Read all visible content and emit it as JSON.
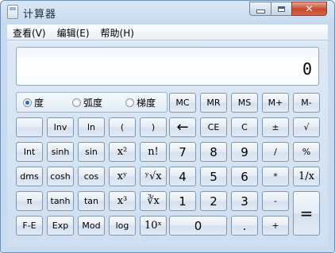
{
  "window": {
    "title": "计算器",
    "close_label": "✕"
  },
  "menu": [
    "查看(V)",
    "编辑(E)",
    "帮助(H)"
  ],
  "display": {
    "value": "0"
  },
  "angle_units": [
    {
      "label": "度",
      "selected": true
    },
    {
      "label": "弧度",
      "selected": false
    },
    {
      "label": "梯度",
      "selected": false
    }
  ],
  "memory_buttons": [
    "MC",
    "MR",
    "MS",
    "M+",
    "M-"
  ],
  "rows": {
    "r1": [
      "",
      "Inv",
      "ln",
      "(",
      ")",
      "←",
      "CE",
      "C",
      "±",
      "√"
    ],
    "r2": [
      "Int",
      "sinh",
      "sin",
      "x²",
      "n!",
      "7",
      "8",
      "9",
      "/",
      "%"
    ],
    "r3": [
      "dms",
      "cosh",
      "cos",
      "xʸ",
      "ʸ√x",
      "4",
      "5",
      "6",
      "*",
      "1/x"
    ],
    "r4": [
      "π",
      "tanh",
      "tan",
      "x³",
      "∛x",
      "1",
      "2",
      "3",
      "-",
      "="
    ],
    "r5": [
      "F-E",
      "Exp",
      "Mod",
      "log",
      "10ˣ",
      "0",
      ".",
      "+"
    ]
  }
}
